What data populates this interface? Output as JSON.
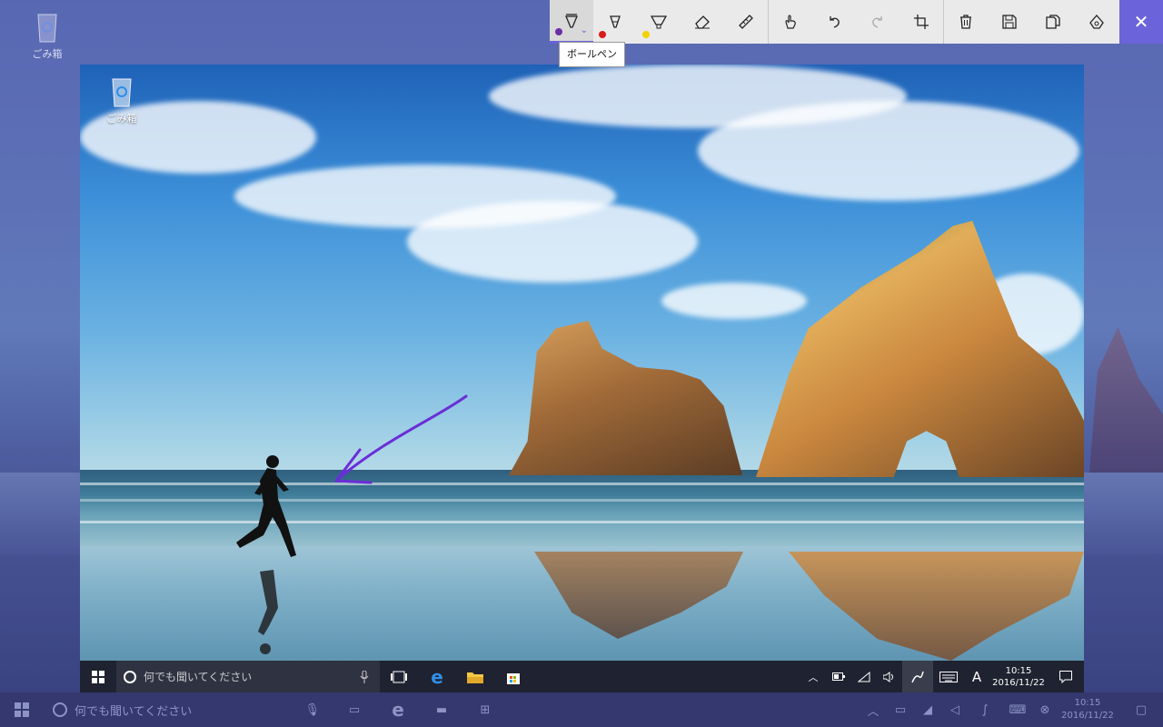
{
  "desktop": {
    "recycle_bin_label": "ごみ箱"
  },
  "toolbar": {
    "tools": [
      {
        "name": "ballpoint-pen",
        "dot_color": "#6a2ea6"
      },
      {
        "name": "pencil",
        "dot_color": "#d81c1c"
      },
      {
        "name": "highlighter",
        "dot_color": "#f2d200"
      },
      {
        "name": "eraser"
      },
      {
        "name": "ruler"
      },
      {
        "name": "touch-writing"
      },
      {
        "name": "undo"
      },
      {
        "name": "redo"
      },
      {
        "name": "crop"
      },
      {
        "name": "delete"
      },
      {
        "name": "save"
      },
      {
        "name": "copy"
      },
      {
        "name": "share"
      }
    ],
    "close_glyph": "✕",
    "tooltip": "ボールペン"
  },
  "inner_taskbar": {
    "search_placeholder": "何でも聞いてください",
    "clock_time": "10:15",
    "clock_date": "2016/11/22",
    "ime": "A"
  },
  "outer_taskbar": {
    "search_placeholder": "何でも聞いてください",
    "clock_time": "10:15",
    "clock_date": "2016/11/22"
  },
  "colors": {
    "accent": "#6b63d9",
    "ink": "#6a2ed8"
  }
}
